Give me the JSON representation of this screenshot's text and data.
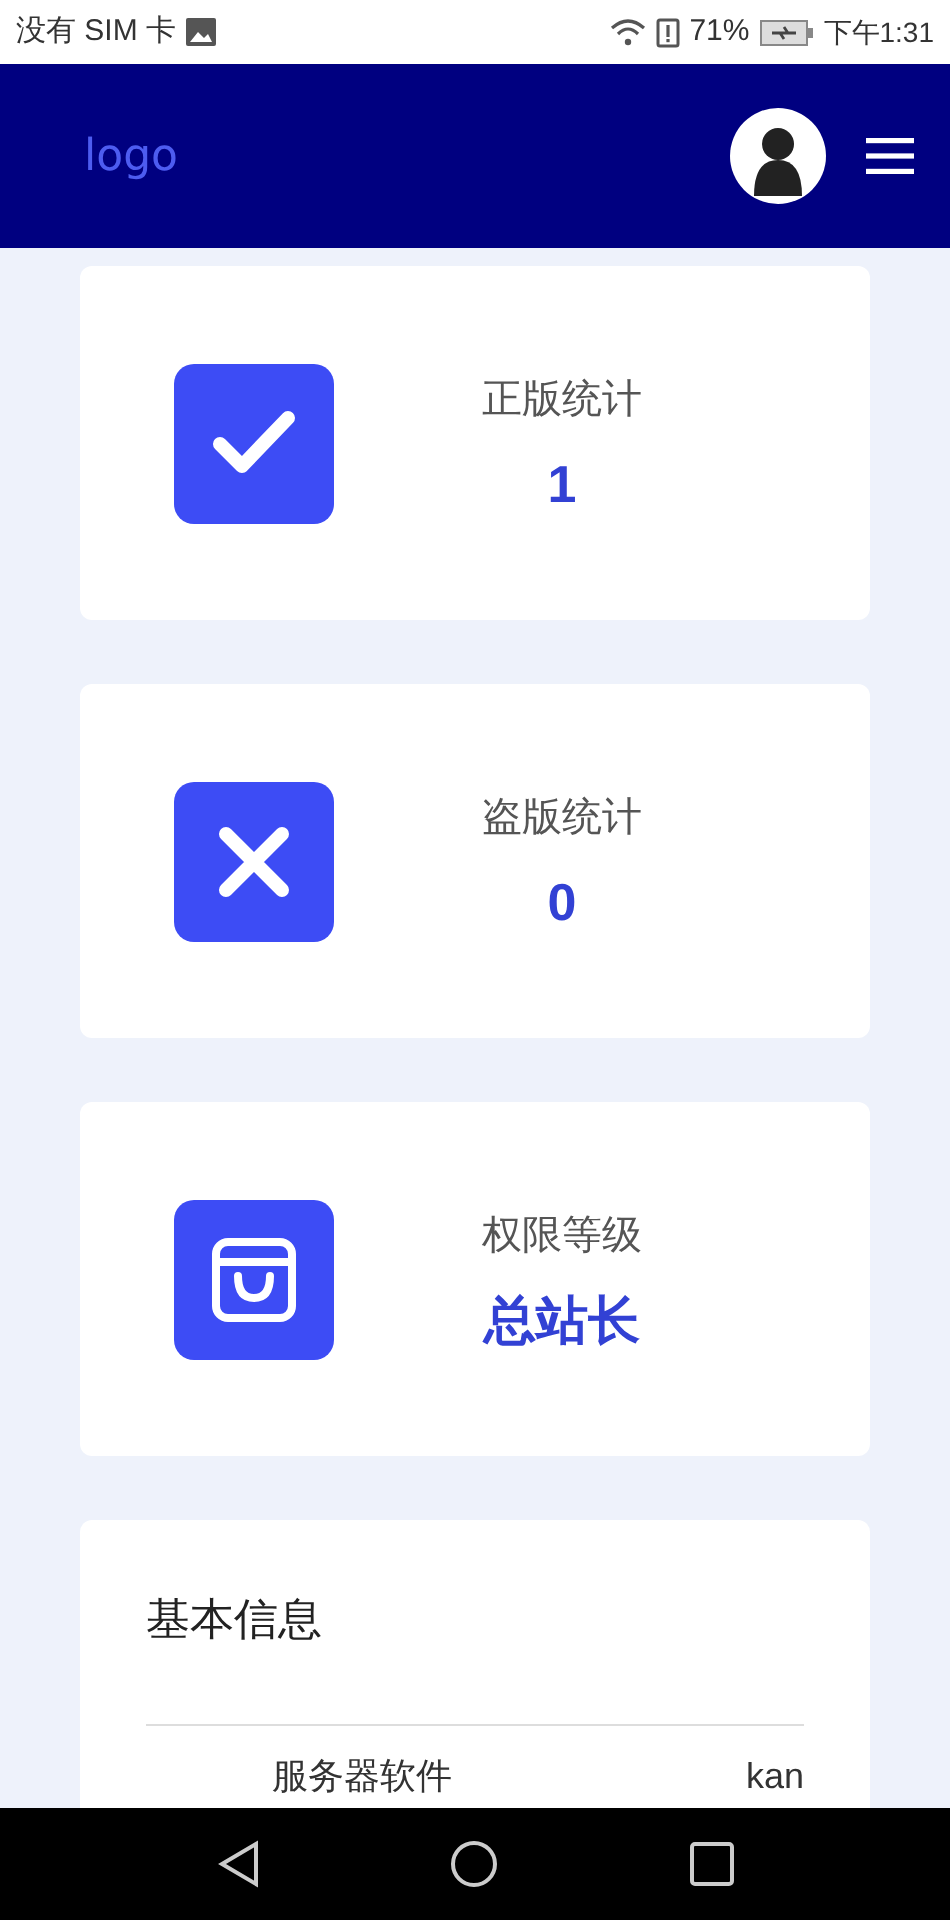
{
  "status_bar": {
    "carrier": "没有 SIM 卡",
    "battery": "71%",
    "time": "下午1:31"
  },
  "header": {
    "logo": "logo"
  },
  "stats": [
    {
      "kind": "check",
      "label": "正版统计",
      "value": "1"
    },
    {
      "kind": "cross",
      "label": "盗版统计",
      "value": "0"
    },
    {
      "kind": "bag",
      "label": "权限等级",
      "value": "总站长"
    }
  ],
  "info": {
    "title": "基本信息",
    "rows": [
      {
        "key": "服务器软件",
        "value": "kan"
      }
    ]
  }
}
